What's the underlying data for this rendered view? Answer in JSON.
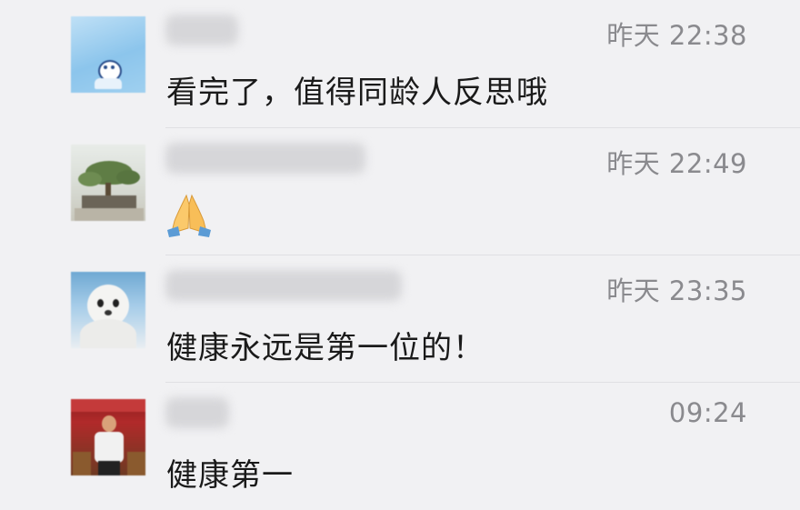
{
  "comments": [
    {
      "avatar_icon": "cartoon-avatar-icon",
      "timestamp": "昨天 22:38",
      "text": "看完了，值得同龄人反思哦"
    },
    {
      "avatar_icon": "bonsai-avatar-icon",
      "timestamp": "昨天 22:49",
      "text": "",
      "emoji": "praying-hands-icon"
    },
    {
      "avatar_icon": "seal-avatar-icon",
      "timestamp": "昨天 23:35",
      "text": "健康永远是第一位的！"
    },
    {
      "avatar_icon": "person-avatar-icon",
      "timestamp": "09:24",
      "text": "健康第一"
    }
  ],
  "colors": {
    "background": "#f1f1f3",
    "timestamp": "#8a8a8e",
    "text": "#1a1a1a"
  }
}
